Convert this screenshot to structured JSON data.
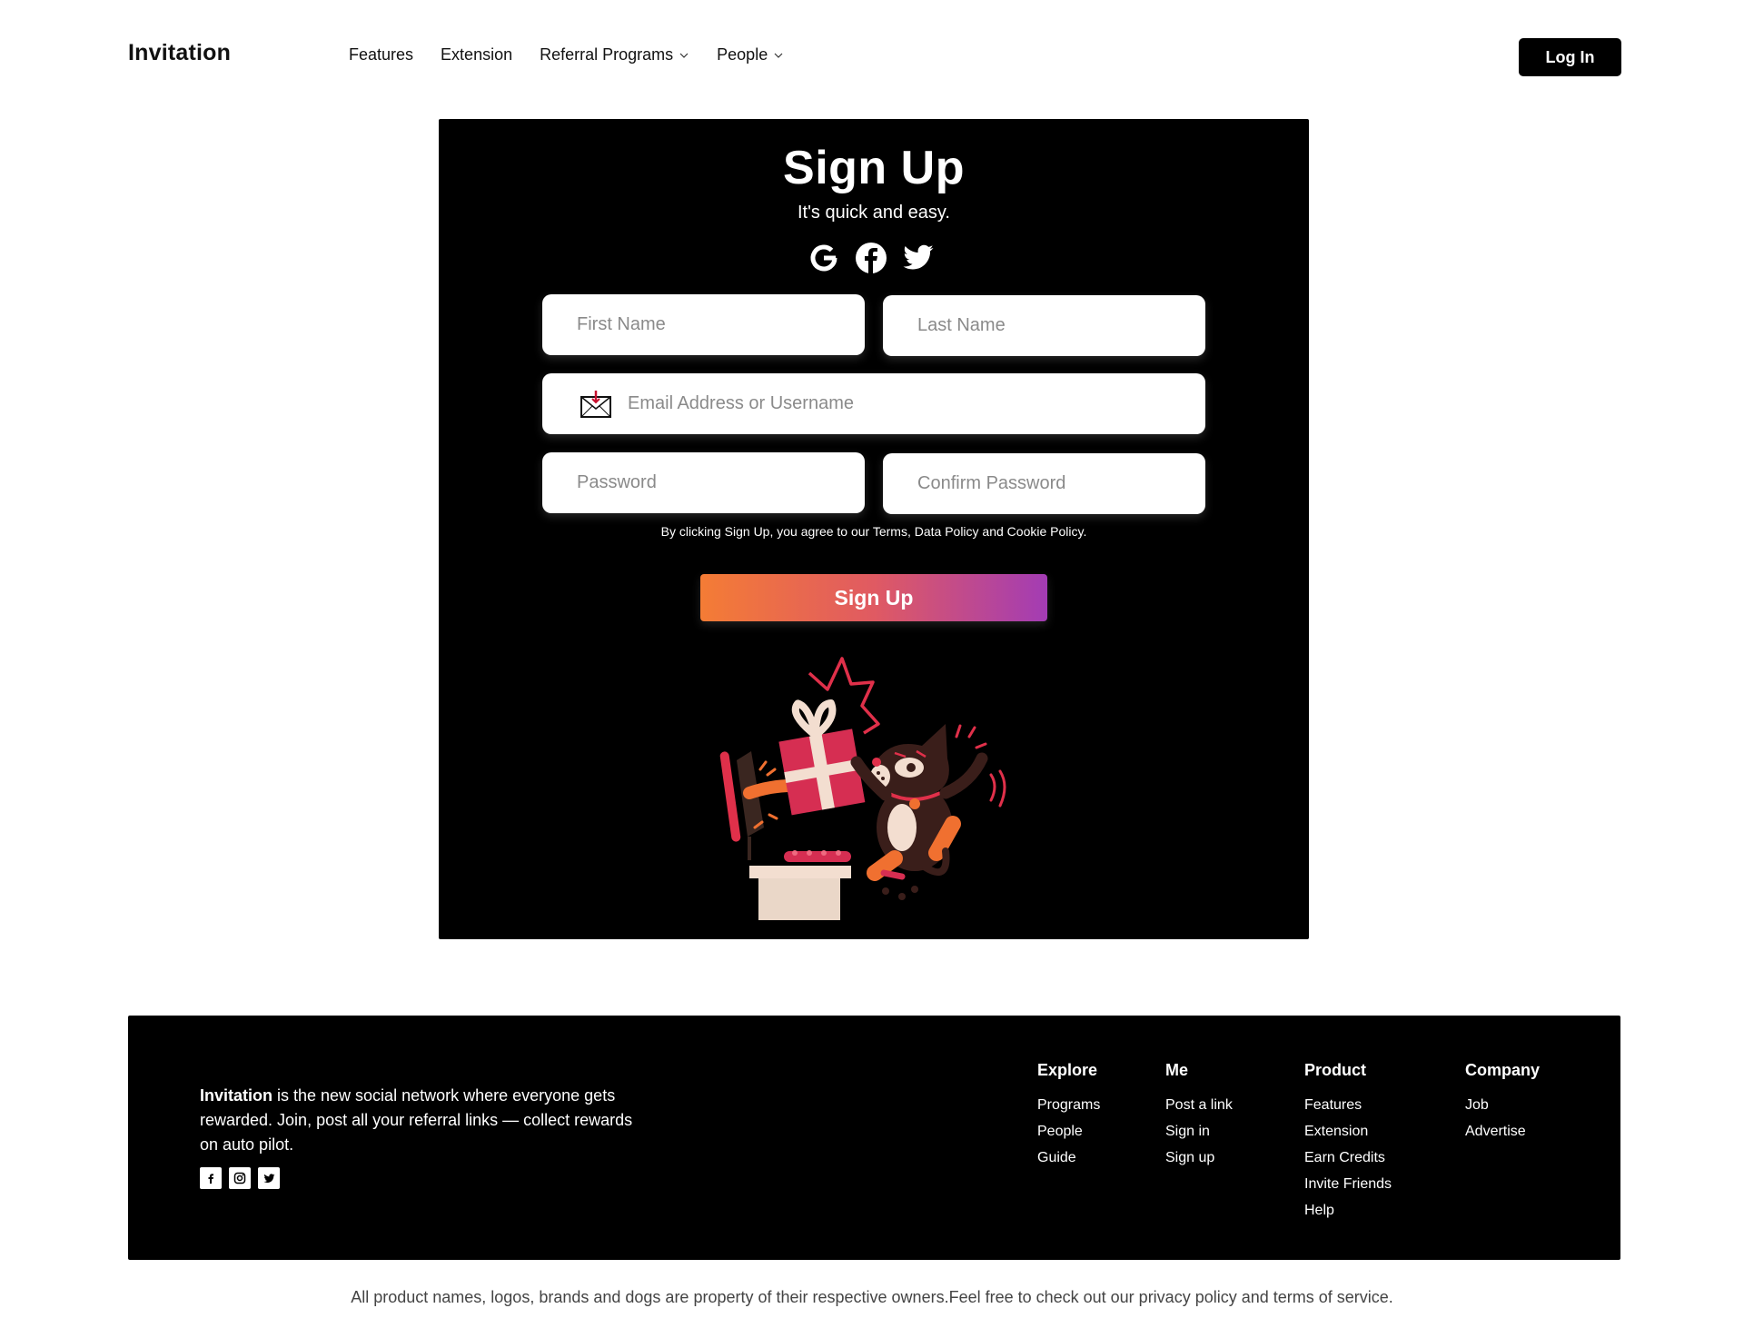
{
  "header": {
    "brand": "Invitation",
    "nav": [
      {
        "label": "Features",
        "dropdown": false
      },
      {
        "label": "Extension",
        "dropdown": false
      },
      {
        "label": "Referral Programs",
        "dropdown": true
      },
      {
        "label": "People",
        "dropdown": true
      }
    ],
    "login_label": "Log In"
  },
  "signup": {
    "title": "Sign Up",
    "subtitle": "It's quick and easy.",
    "socials": [
      "google-icon",
      "facebook-icon",
      "twitter-icon"
    ],
    "fields": {
      "first_name_placeholder": "First Name",
      "last_name_placeholder": "Last Name",
      "email_placeholder": "Email Address or Username",
      "password_placeholder": "Password",
      "confirm_password_placeholder": "Confirm Password"
    },
    "terms": "By clicking Sign Up, you agree to our Terms, Data Policy and Cookie Policy.",
    "button_label": "Sign Up",
    "button_gradient": [
      "#f47c35",
      "#a33cb4"
    ]
  },
  "footer": {
    "brand": "Invitation",
    "about": " is the new social network where everyone gets rewarded. Join, post all your referral links — collect rewards on auto pilot.",
    "social_icons": [
      "facebook-icon",
      "instagram-icon",
      "twitter-icon"
    ],
    "columns": [
      {
        "title": "Explore",
        "links": [
          "Programs",
          "People",
          "Guide"
        ]
      },
      {
        "title": "Me",
        "links": [
          "Post a link",
          "Sign in",
          "Sign up"
        ]
      },
      {
        "title": "Product",
        "links": [
          "Features",
          "Extension",
          "Earn Credits",
          "Invite Friends",
          "Help"
        ]
      },
      {
        "title": "Company",
        "links": [
          "Job",
          "Advertise"
        ]
      }
    ]
  },
  "legal": "All product names, logos, brands and dogs are property of their respective owners.Feel free to check out our privacy policy and terms of service."
}
